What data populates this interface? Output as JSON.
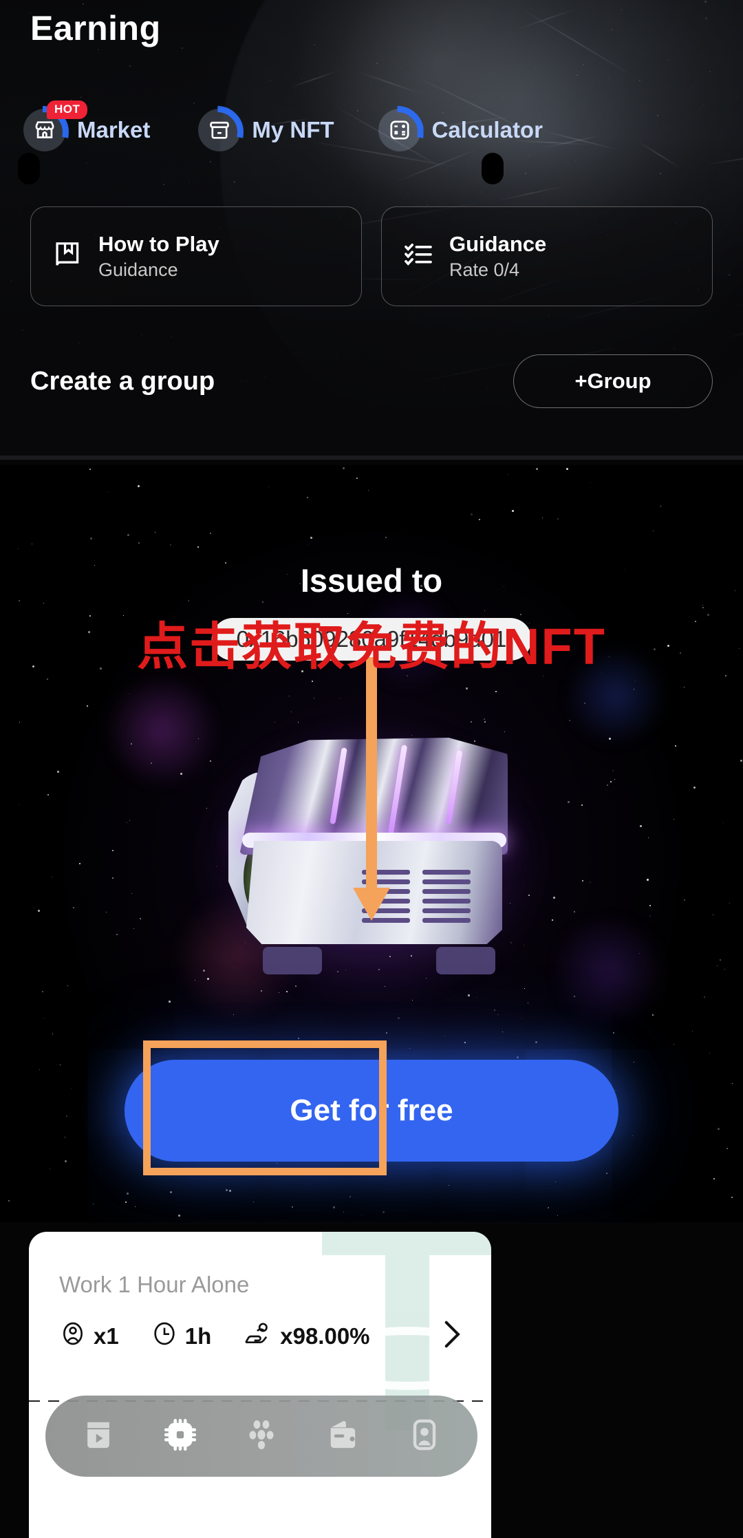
{
  "header": {
    "title": "Earning"
  },
  "nav": {
    "items": [
      {
        "label": "Market",
        "icon": "shop-icon",
        "badge": "HOT"
      },
      {
        "label": "My NFT",
        "icon": "archive-box-icon",
        "badge": ""
      },
      {
        "label": "Calculator",
        "icon": "calculator-icon",
        "badge": ""
      }
    ]
  },
  "info_cards": [
    {
      "title": "How to Play",
      "subtitle": "Guidance",
      "icon": "book-bookmark-icon"
    },
    {
      "title": "Guidance",
      "subtitle": "Rate 0/4",
      "icon": "checklist-icon"
    }
  ],
  "group_section": {
    "title": "Create a group",
    "button_label": "+Group"
  },
  "nft_banner": {
    "issued_to_label": "Issued to",
    "address": "0x16b609280a9f14db9d01",
    "cta_label": "Get for free",
    "artwork": "nft-loot-chest"
  },
  "annotation": {
    "text": "点击获取免费的NFT",
    "color": "#e01b1b",
    "arrow_color": "#f5a25a",
    "highlight_box_color": "#f5a25a"
  },
  "work_card": {
    "title": "Work 1 Hour Alone",
    "stats": [
      {
        "icon": "person-circle-icon",
        "value": "x1"
      },
      {
        "icon": "clock-icon",
        "value": "1h"
      },
      {
        "icon": "hand-coin-icon",
        "value": "x98.00%"
      }
    ],
    "chevron": "chevron-right-icon",
    "watermark": "tether-logo"
  },
  "tabbar": {
    "items": [
      {
        "name": "tab-media",
        "icon": "media-play-icon",
        "active": false
      },
      {
        "name": "tab-chip",
        "icon": "cpu-chip-icon",
        "active": true
      },
      {
        "name": "tab-team",
        "icon": "people-group-icon",
        "active": false
      },
      {
        "name": "tab-wallet",
        "icon": "wallet-icon",
        "active": false
      },
      {
        "name": "tab-profile",
        "icon": "profile-card-icon",
        "active": false
      }
    ]
  },
  "colors": {
    "accent_blue": "#3365f0",
    "nav_label": "#c8d8f6",
    "hot_badge": "#ef2236",
    "annotation_red": "#e01b1b",
    "annotation_orange": "#f5a25a"
  }
}
